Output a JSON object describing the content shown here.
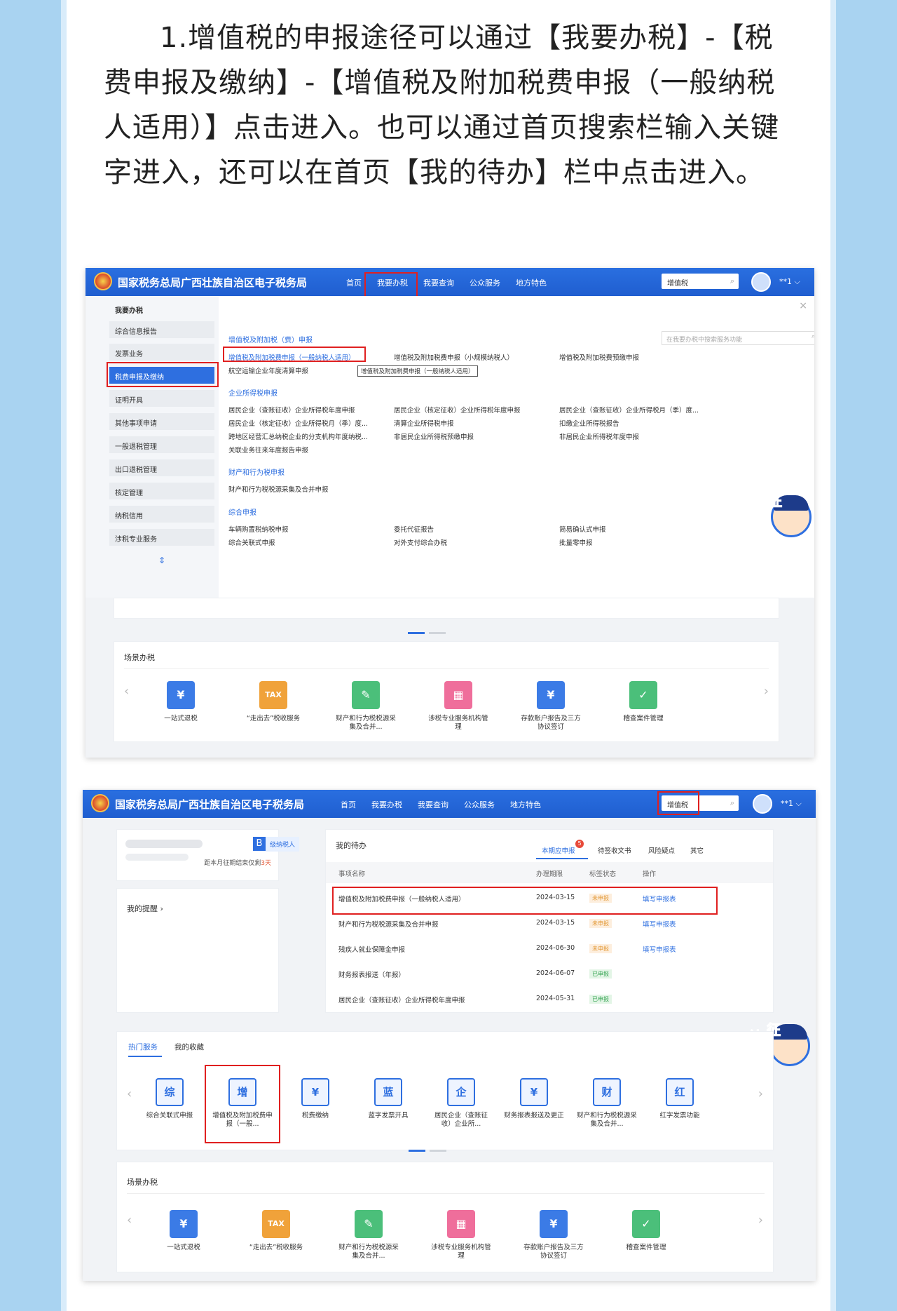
{
  "intro": "1.增值税的申报途径可以通过【我要办税】-【税费申报及缴纳】-【增值税及附加税费申报（一般纳税人适用）】点击进入。也可以通过首页搜索栏输入关键字进入，还可以在首页【我的待办】栏中点击进入。",
  "brand": "国家税务总局广西壮族自治区电子税务局",
  "nav": [
    "首页",
    "我要办税",
    "我要查询",
    "公众服务",
    "地方特色"
  ],
  "search_value": "增值税",
  "user": "**1 ⌵",
  "s1": {
    "side_title": "我要办税",
    "side_items": [
      "综合信息报告",
      "发票业务",
      "税费申报及缴纳",
      "证明开具",
      "其他事项申请",
      "一般退税管理",
      "出口退税管理",
      "核定管理",
      "纳税信用",
      "涉税专业服务"
    ],
    "panel_search": "在我要办税中搜索服务功能",
    "sec1": "增值税及附加税（费）申报",
    "sec1_links": [
      "增值税及附加税费申报（一般纳税人适用）",
      "增值税及附加税费申报（小规模纳税人）",
      "增值税及附加税费预缴申报",
      "航空运输企业年度清算申报"
    ],
    "tooltip": "增值税及附加税费申报（一般纳税人适用）",
    "sec2": "企业所得税申报",
    "sec2_links": [
      "居民企业（查账征收）企业所得税年度申报",
      "居民企业（核定征收）企业所得税年度申报",
      "居民企业（查账征收）企业所得税月（季）度...",
      "居民企业（核定征收）企业所得税月（季）度...",
      "清算企业所得税申报",
      "扣缴企业所得税报告",
      "跨地区经营汇总纳税企业的分支机构年度纳税...",
      "非居民企业所得税预缴申报",
      "非居民企业所得税年度申报",
      "关联业务往来年度报告申报"
    ],
    "sec3": "财产和行为税申报",
    "sec3_links": [
      "财产和行为税税源采集及合并申报"
    ],
    "sec4": "综合申报",
    "sec4_links": [
      "车辆购置税纳税申报",
      "委托代征报告",
      "简易确认式申报",
      "综合关联式申报",
      "对外支付综合办税",
      "批量零申报"
    ],
    "close": "×"
  },
  "scene_title": "场景办税",
  "scene": [
    {
      "icon": "¥",
      "label": "一站式退税",
      "color": "#3b7be6"
    },
    {
      "icon": "TAX",
      "label": "“走出去”税收服务",
      "color": "#f0a23a"
    },
    {
      "icon": "✎",
      "label": "财产和行为税税源采集及合并...",
      "color": "#4bbf7a"
    },
    {
      "icon": "▦",
      "label": "涉税专业服务机构管理",
      "color": "#ef6e9b"
    },
    {
      "icon": "¥",
      "label": "存款账户报告及三方协议签订",
      "color": "#3b7be6"
    },
    {
      "icon": "✓",
      "label": "稽查案件管理",
      "color": "#4bbf7a"
    }
  ],
  "mascot": [
    "纳",
    "征",
    "互",
    "动"
  ],
  "s2": {
    "badge": "B",
    "level": "级纳税人",
    "deadline_prefix": "距本月征期结束仅剩",
    "deadline_days": "3天",
    "reminder": "我的提醒 ›",
    "todo_title": "我的待办",
    "todo_tabs": [
      "本期应申报",
      "待签收文书",
      "风险疑点",
      "其它"
    ],
    "todo_count": "5",
    "todo_head": [
      "事项名称",
      "办理期限",
      "标签状态",
      "操作"
    ],
    "todo_rows": [
      {
        "name": "增值税及附加税费申报（一般纳税人适用）",
        "date": "2024-03-15",
        "status": "未申报",
        "op": "填写申报表",
        "ok": false
      },
      {
        "name": "财产和行为税税源采集及合并申报",
        "date": "2024-03-15",
        "status": "未申报",
        "op": "填写申报表",
        "ok": false
      },
      {
        "name": "残疾人就业保障金申报",
        "date": "2024-06-30",
        "status": "未申报",
        "op": "填写申报表",
        "ok": false
      },
      {
        "name": "财务报表报送（年报）",
        "date": "2024-06-07",
        "status": "已申报",
        "op": "",
        "ok": true
      },
      {
        "name": "居民企业（查账征收）企业所得税年度申报",
        "date": "2024-05-31",
        "status": "已申报",
        "op": "",
        "ok": true
      }
    ],
    "hot_tabs": [
      "热门服务",
      "我的收藏"
    ],
    "hot": [
      {
        "icon": "综",
        "label": "综合关联式申报"
      },
      {
        "icon": "增",
        "label": "增值税及附加税费申报（一般..."
      },
      {
        "icon": "¥",
        "label": "税费缴纳"
      },
      {
        "icon": "蓝",
        "label": "蓝字发票开具"
      },
      {
        "icon": "企",
        "label": "居民企业（查账征收）企业所..."
      },
      {
        "icon": "¥",
        "label": "财务报表报送及更正"
      },
      {
        "icon": "财",
        "label": "财产和行为税税源采集及合并..."
      },
      {
        "icon": "红",
        "label": "红字发票功能"
      }
    ]
  }
}
